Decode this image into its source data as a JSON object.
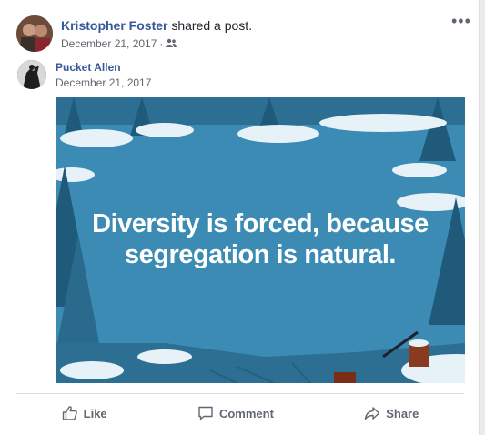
{
  "post": {
    "sharer": {
      "name": "Kristopher Foster",
      "action": "shared a post.",
      "date": "December 21, 2017",
      "audience_icon": "friends-icon"
    },
    "original": {
      "name": "Pucket Allen",
      "date": "December 21, 2017"
    },
    "image_text": "Diversity is forced, because segregation is natural.",
    "more_icon": "•••"
  },
  "actions": {
    "like": {
      "label": "Like",
      "icon": "thumbs-up-icon"
    },
    "comment": {
      "label": "Comment",
      "icon": "speech-bubble-icon"
    },
    "share": {
      "label": "Share",
      "icon": "share-arrow-icon"
    }
  },
  "colors": {
    "link": "#365899",
    "meta": "#616770",
    "image_bg": "#3b8bb4"
  }
}
